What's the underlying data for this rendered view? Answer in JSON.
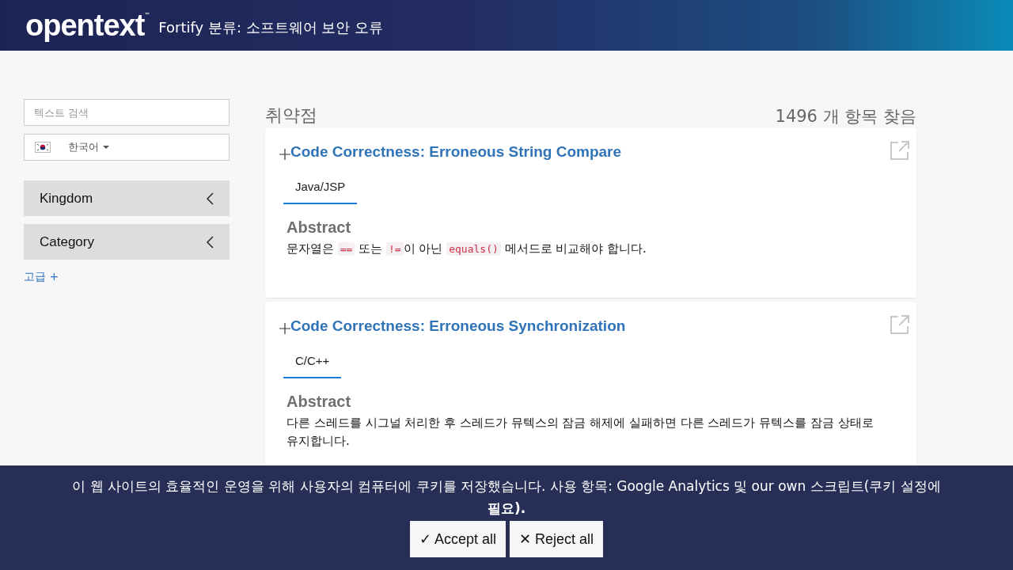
{
  "header": {
    "logo": "opentext",
    "trademark": "™",
    "title": "Fortify 분류: 소프트웨어 보안 오류"
  },
  "sidebar": {
    "search": {
      "placeholder": "텍스트 검색"
    },
    "language": {
      "value": "한국어"
    },
    "filters": [
      {
        "label": "Kingdom",
        "expanded": false
      },
      {
        "label": "Category",
        "expanded": false
      }
    ],
    "advanced_link": "고급 +"
  },
  "results": {
    "heading": "취약점",
    "count": "1496 개 항목 찾음",
    "items": [
      {
        "title": "Code Correctness: Erroneous String Compare",
        "tabs": [
          {
            "label": "Java/JSP",
            "selected": true
          }
        ],
        "abstract_heading": "Abstract",
        "abstract": [
          {
            "kind": "text",
            "text": "문자열은 "
          },
          {
            "kind": "code",
            "text": "=="
          },
          {
            "kind": "text",
            "text": " 또는 "
          },
          {
            "kind": "code",
            "text": "!="
          },
          {
            "kind": "text",
            "text": "이 아닌 "
          },
          {
            "kind": "code",
            "text": "equals()"
          },
          {
            "kind": "text",
            "text": " 메서드로 비교해야 합니다."
          }
        ]
      },
      {
        "title": "Code Correctness: Erroneous Synchronization",
        "tabs": [
          {
            "label": "C/C++",
            "selected": true
          }
        ],
        "abstract_heading": "Abstract",
        "abstract": [
          {
            "kind": "text",
            "text": "다른 스레드를 시그널 처리한 후 스레드가 뮤텍스의 잠금 해제에 실패하면 다른 스레드가 뮤텍스를 잠금 상태로 유지합니다."
          }
        ]
      }
    ]
  },
  "cookie_banner": {
    "message": "이 웹 사이트의 효율적인 운영을 위해 사용자의 컴퓨터에 쿠키를 저장했습니다. 사용 항목: Google Analytics 및 our own 스크립트(쿠키 설정에 **필요).**",
    "buttons": [
      {
        "icon": "✓",
        "label": "Accept all"
      },
      {
        "icon": "✕",
        "label": "Reject all"
      }
    ]
  }
}
